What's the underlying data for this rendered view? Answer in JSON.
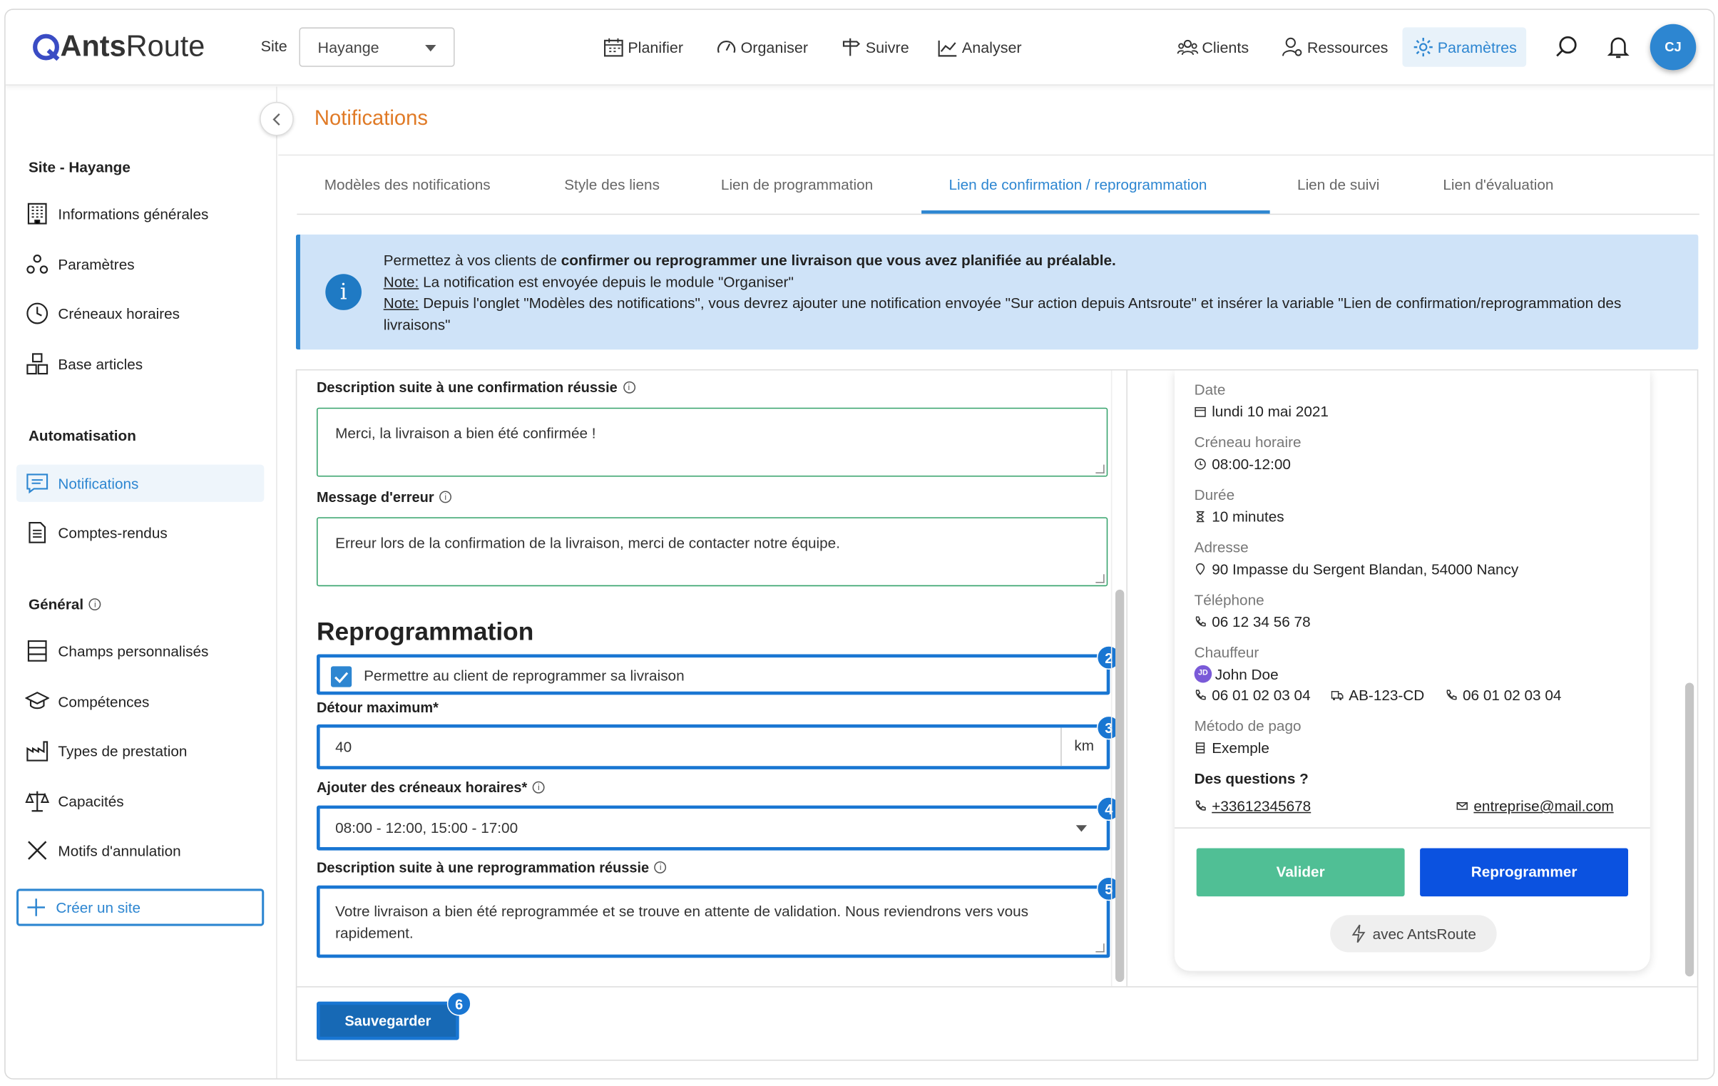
{
  "brand": {
    "name_part1": "Ants",
    "name_part2": "Route"
  },
  "header": {
    "site_label": "Site",
    "site_value": "Hayange",
    "nav": [
      "Planifier",
      "Organiser",
      "Suivre",
      "Analyser"
    ],
    "right_nav": [
      "Clients",
      "Ressources",
      "Paramètres"
    ],
    "avatar": "CJ"
  },
  "sidebar": {
    "site_section": "Site - Hayange",
    "site_items": [
      "Informations générales",
      "Paramètres",
      "Créneaux horaires",
      "Base articles"
    ],
    "auto_section": "Automatisation",
    "auto_items": [
      "Notifications",
      "Comptes-rendus"
    ],
    "general_section": "Général",
    "general_items": [
      "Champs personnalisés",
      "Compétences",
      "Types de prestation",
      "Capacités",
      "Motifs d'annulation"
    ],
    "create_label": "Créer un site"
  },
  "page": {
    "title": "Notifications",
    "tabs": [
      "Modèles des notifications",
      "Style des liens",
      "Lien de programmation",
      "Lien de confirmation / reprogrammation",
      "Lien de suivi",
      "Lien d'évaluation"
    ],
    "active_tab": "Lien de confirmation / reprogrammation"
  },
  "info": {
    "line1_pre": "Permettez à vos clients de ",
    "line1_bold": "confirmer ou reprogrammer une livraison que vous avez planifiée au préalable.",
    "note": "Note:",
    "line2": " La notification est envoyée depuis le module \"Organiser\"",
    "line3": " Depuis l'onglet \"Modèles des notifications\", vous devrez ajouter une notification envoyée \"Sur action depuis Antsroute\" et insérer la variable \"Lien de confirmation/reprogrammation des livraisons\""
  },
  "form": {
    "confirm_desc_label": "Description suite à une confirmation réussie",
    "confirm_desc_value": "Merci, la livraison a bien été confirmée !",
    "error_label": "Message d'erreur",
    "error_value": "Erreur lors de la confirmation de la livraison, merci de contacter notre équipe.",
    "section_title": "Reprogrammation",
    "allow_label": "Permettre au client de reprogrammer sa livraison",
    "allow_checked": true,
    "detour_label": "Détour maximum*",
    "detour_value": "40",
    "detour_unit": "km",
    "slots_label": "Ajouter des créneaux horaires*",
    "slots_value": "08:00 - 12:00, 15:00 - 17:00",
    "resched_desc_label": "Description suite à une reprogrammation réussie",
    "resched_desc_value": "Votre livraison a bien été reprogrammée et se trouve en attente de validation. Nous reviendrons vers vous rapidement.",
    "save_label": "Sauvegarder",
    "badges": [
      "2",
      "3",
      "4",
      "5",
      "6"
    ]
  },
  "preview": {
    "date_label": "Date",
    "date_value": "lundi 10 mai 2021",
    "slot_label": "Créneau horaire",
    "slot_value": "08:00-12:00",
    "duration_label": "Durée",
    "duration_value": "10 minutes",
    "address_label": "Adresse",
    "address_value": "90 Impasse du Sergent Blandan, 54000 Nancy",
    "phone_label": "Téléphone",
    "phone_value": "06 12 34 56 78",
    "driver_label": "Chauffeur",
    "driver_initials": "JD",
    "driver_name": "John Doe",
    "driver_phone": "06 01 02 03 04",
    "plate": "AB-123-CD",
    "driver_phone2": "06 01 02 03 04",
    "payment_label": "Método de pago",
    "payment_value": "Exemple",
    "questions_label": "Des questions ?",
    "contact_phone": "+33612345678",
    "contact_email": "entreprise@mail.com",
    "validate_label": "Valider",
    "reschedule_label": "Reprogrammer",
    "powered_label": "avec AntsRoute"
  },
  "colors": {
    "accent": "#2d86d1",
    "title": "#e07a26",
    "highlight": "#1976d2",
    "validate": "#50bf95",
    "reschedule": "#0b52e0"
  }
}
